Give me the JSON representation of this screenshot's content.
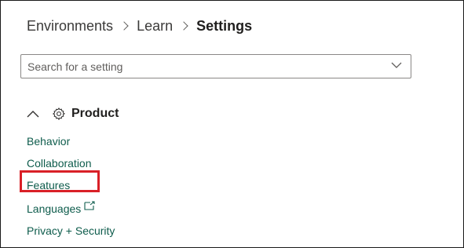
{
  "breadcrumb": {
    "items": [
      "Environments",
      "Learn"
    ],
    "current": "Settings"
  },
  "search": {
    "placeholder": "Search for a setting",
    "value": ""
  },
  "section": {
    "title": "Product",
    "expanded": true,
    "links": [
      "Behavior",
      "Collaboration",
      "Features",
      "Languages",
      "Privacy + Security"
    ]
  },
  "colors": {
    "link": "#0e5c4c",
    "highlight": "#d92027",
    "text": "#201f1e"
  }
}
